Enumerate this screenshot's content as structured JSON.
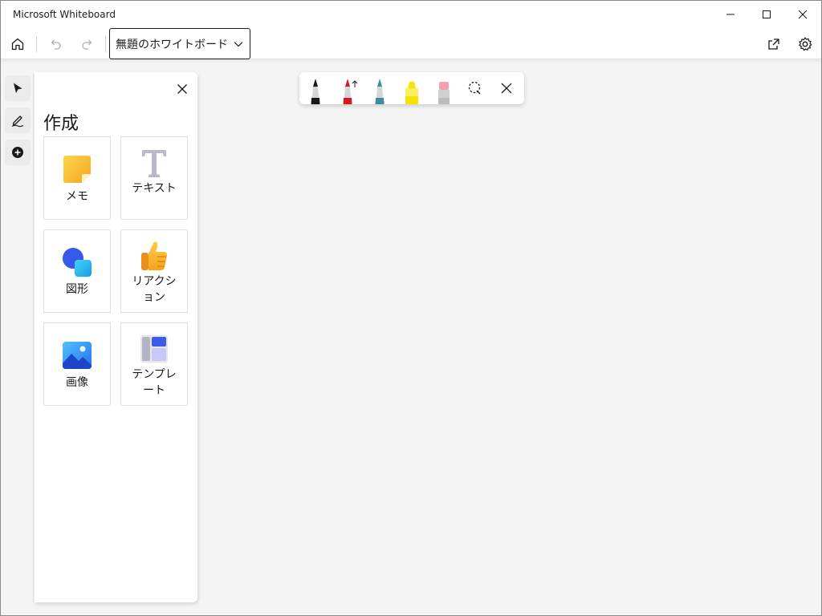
{
  "window": {
    "title": "Microsoft Whiteboard"
  },
  "toolbar": {
    "board_title": "無題のホワイトボード"
  },
  "rail": {
    "items": [
      {
        "name": "select",
        "icon": "pointer-icon"
      },
      {
        "name": "ink",
        "icon": "pen-sign-icon"
      },
      {
        "name": "add",
        "icon": "plus-circle-icon"
      }
    ]
  },
  "panel": {
    "heading": "作成",
    "tiles": [
      {
        "label": "メモ",
        "icon": "sticky-note-icon"
      },
      {
        "label": "テキスト",
        "icon": "text-icon"
      },
      {
        "label": "図形",
        "icon": "shapes-icon"
      },
      {
        "label": "リアクション",
        "icon": "thumbs-up-icon"
      },
      {
        "label": "画像",
        "icon": "image-icon"
      },
      {
        "label": "テンプレート",
        "icon": "template-icon"
      }
    ]
  },
  "pen_toolbar": {
    "tools": [
      {
        "name": "black-pen",
        "color": "#1a1a1a"
      },
      {
        "name": "red-pen",
        "color": "#d11a2a"
      },
      {
        "name": "teal-pen",
        "color": "#3c8c9c"
      },
      {
        "name": "highlighter",
        "color": "#f5e400"
      },
      {
        "name": "eraser",
        "color": "#f2a0b0"
      }
    ]
  }
}
